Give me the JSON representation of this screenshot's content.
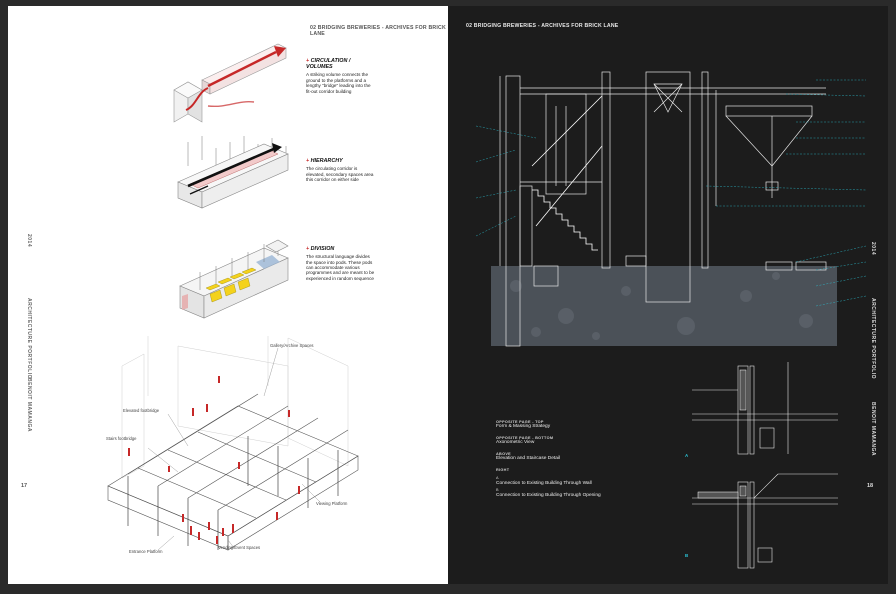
{
  "left_page": {
    "header": "02 BRIDGING BREWERIES - ARCHIVES FOR BRICK LANE",
    "side_year": "2014",
    "side_title": "ARCHITECTURE PORTFOLIO",
    "side_author": "BENOIT MAMANGA",
    "page_number": "17",
    "diagrams": [
      {
        "title": "CIRCULATION / VOLUMES",
        "text": "A striking volume connects the ground to the platforms and a lengthy \"bridge\" leading into the fit-out corridor building"
      },
      {
        "title": "HIERARCHY",
        "text": "The circulating corridor is elevated, secondary spaces area this corridor on either side"
      },
      {
        "title": "DIVISION",
        "text": "The structural language divides the space into pods. These pods can accommodate various programmes and are meant to be experienced in random sequence"
      }
    ],
    "axo_labels": {
      "gallery": "Gallery/Archive Spaces",
      "elevated_footbridge": "Elevated footbridge",
      "stairs_footbridge": "Stairs footbridge",
      "viewing_platform": "Viewing Platform",
      "entrance_platform": "Entrance Platform",
      "vending": "Vending/Event Spaces"
    }
  },
  "right_page": {
    "header": "02 BRIDGING BREWERIES - ARCHIVES FOR BRICK LANE",
    "side_year": "2014",
    "side_title": "ARCHITECTURE PORTFOLIO",
    "side_author": "BENOIT MAMANGA",
    "page_number": "18",
    "legend": [
      {
        "head": "OPPOSITE PAGE - TOP",
        "text": "Form & Massing Strategy"
      },
      {
        "head": "OPPOSITE PAGE - BOTTOM",
        "text": "Axonometric View"
      },
      {
        "head": "ABOVE",
        "text": "Elevation and Staircase Detail"
      },
      {
        "head": "RIGHT",
        "lines": [
          {
            "letter": "A",
            "text": "Connection to Existing Building Through Wall"
          },
          {
            "letter": "B",
            "text": "Connection to Existing Building Through Opening"
          }
        ]
      }
    ],
    "detail_markers": [
      "A",
      "B"
    ]
  },
  "colors": {
    "accent_red": "#c62828",
    "accent_yellow": "#f4d21c",
    "annotation_cyan": "#2bc4d6",
    "dark_page": "#1c1c1c"
  }
}
